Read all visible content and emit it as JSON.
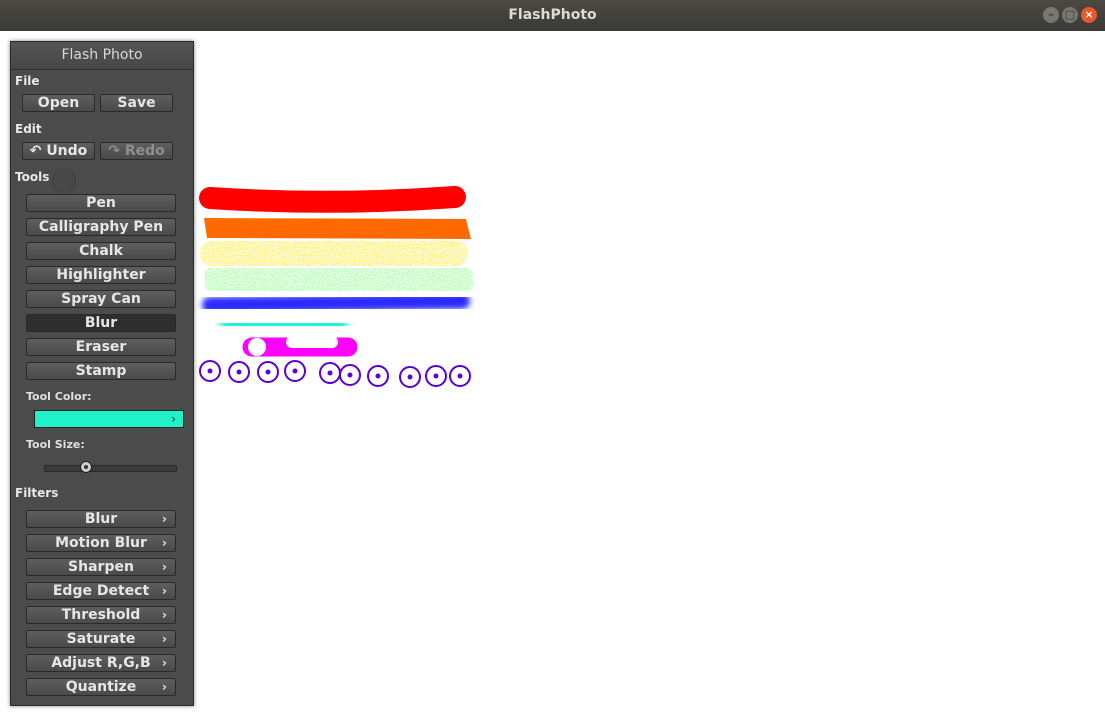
{
  "window": {
    "title": "FlashPhoto"
  },
  "panel": {
    "title": "Flash Photo",
    "file": {
      "label": "File",
      "open": "Open",
      "save": "Save"
    },
    "edit": {
      "label": "Edit",
      "undo": "Undo",
      "redo": "Redo"
    },
    "tools": {
      "label": "Tools",
      "items": [
        "Pen",
        "Calligraphy Pen",
        "Chalk",
        "Highlighter",
        "Spray Can",
        "Blur",
        "Eraser",
        "Stamp"
      ],
      "selected": "Blur"
    },
    "tool_color": {
      "label": "Tool Color:",
      "value": "#1ff2c8"
    },
    "tool_size": {
      "label": "Tool Size:",
      "level": 0.29
    },
    "filters": {
      "label": "Filters",
      "items": [
        "Blur",
        "Motion Blur",
        "Sharpen",
        "Edge Detect",
        "Threshold",
        "Saturate",
        "Adjust R,G,B",
        "Quantize"
      ]
    }
  },
  "icons": {
    "undo": "undo-arrow-icon",
    "redo": "redo-arrow-icon",
    "expand": "chevron-right-icon"
  },
  "canvas_strokes": {
    "colors": [
      "#ff0000",
      "#ff6a00",
      "#ffe400",
      "#5bff5b",
      "#2a2aff",
      "#1ff2d4",
      "#ff00ff",
      "#5a00d6"
    ]
  }
}
